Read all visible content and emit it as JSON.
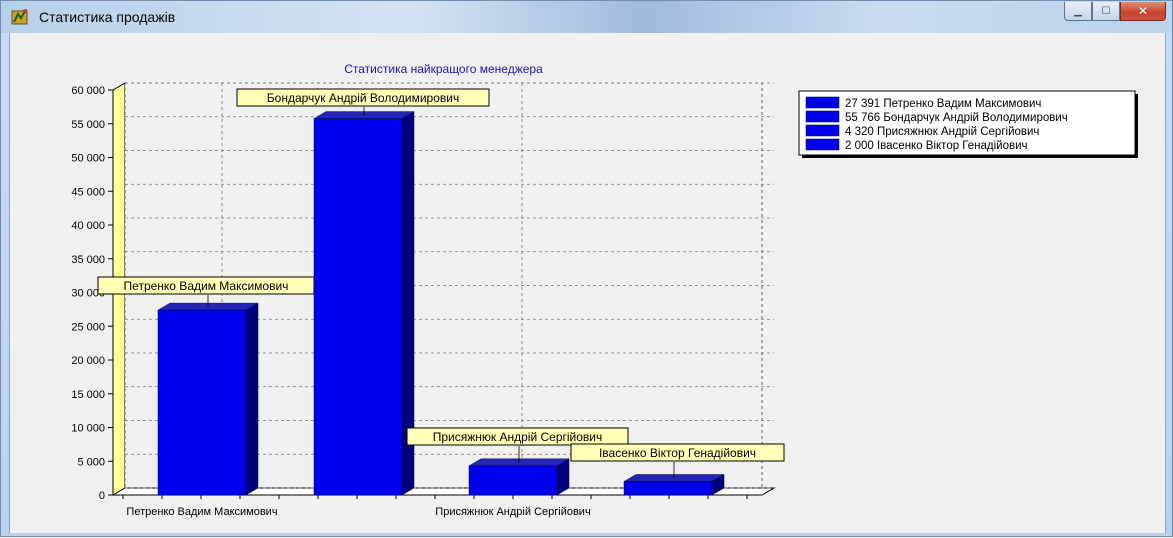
{
  "window": {
    "title": "Статистика продажів",
    "icon": "app-icon",
    "buttons": [
      "minimize-icon",
      "maximize-icon",
      "close-icon"
    ]
  },
  "chart_data": {
    "type": "bar",
    "title": "Статистика найкращого менеджера",
    "categories": [
      "Петренко Вадим Максимович",
      "Бондарчук Андрій Володимирович",
      "Присяжнюк Андрій Сергійович",
      "Івасенко Віктор Генадійович"
    ],
    "values": [
      27391,
      55766,
      4320,
      2000
    ],
    "bar_labels": [
      "Петренко Вадим Максимович",
      "Бондарчук Андрій Володимирович",
      "Присяжнюк Андрій Сергійович",
      "Івасенко Віктор Генадійович"
    ],
    "x_tick_labels": [
      "Петренко Вадим Максимович",
      "",
      "Присяжнюк Андрій Сергійович",
      ""
    ],
    "y_ticks": [
      0,
      5000,
      10000,
      15000,
      20000,
      25000,
      30000,
      35000,
      40000,
      45000,
      50000,
      55000,
      60000
    ],
    "y_tick_labels": [
      "0",
      "5 000",
      "10 000",
      "15 000",
      "20 000",
      "25 000",
      "30 000",
      "35 000",
      "40 000",
      "45 000",
      "50 000",
      "55 000",
      "60 000"
    ],
    "ylim": [
      0,
      60000
    ],
    "legend": [
      "27 391 Петренко Вадим Максимович",
      "55 766 Бондарчук Андрій Володимирович",
      "4 320 Присяжнюк Андрій Сергійович",
      "2 000 Івасенко Віктор Генадійович"
    ],
    "legend_position": "top-right",
    "grid": true,
    "colors": {
      "bar_front": "#0000ee",
      "bar_top": "#2525b8",
      "bar_side": "#00007a",
      "wall": "#ffff99",
      "label_bg": "#ffffb5",
      "title": "#1a1aa0"
    }
  }
}
